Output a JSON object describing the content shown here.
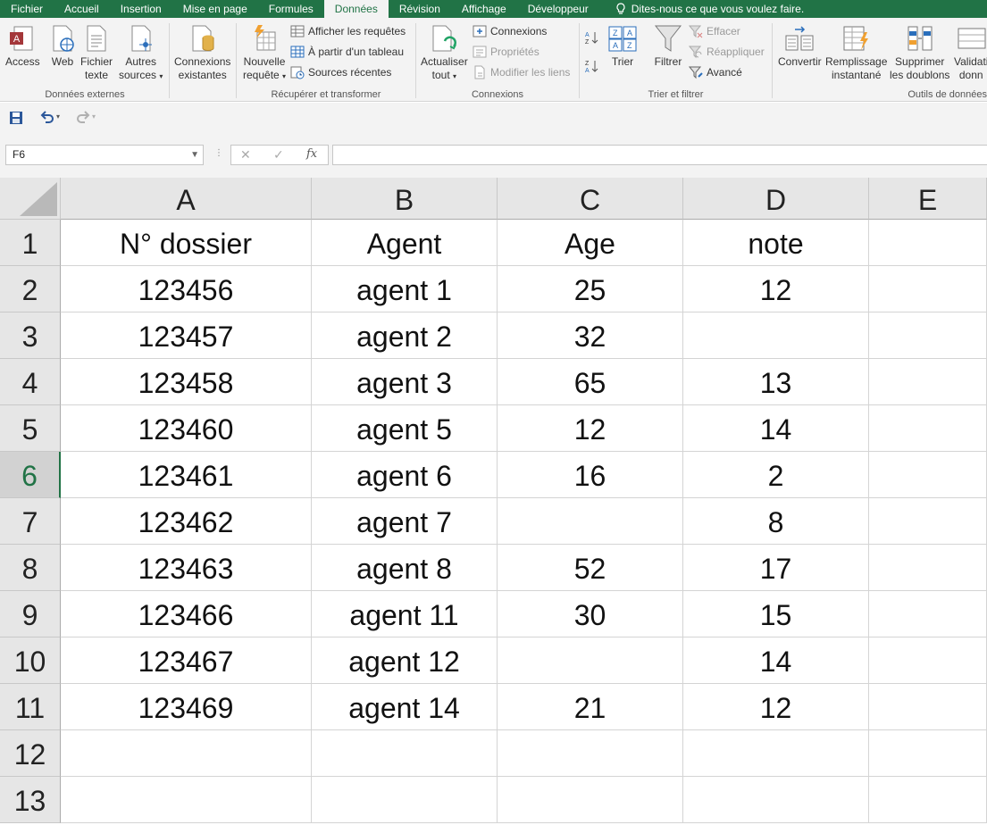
{
  "tabs": [
    {
      "label": "Fichier",
      "active": false
    },
    {
      "label": "Accueil",
      "active": false
    },
    {
      "label": "Insertion",
      "active": false
    },
    {
      "label": "Mise en page",
      "active": false
    },
    {
      "label": "Formules",
      "active": false
    },
    {
      "label": "Données",
      "active": true
    },
    {
      "label": "Révision",
      "active": false
    },
    {
      "label": "Affichage",
      "active": false
    },
    {
      "label": "Développeur",
      "active": false
    }
  ],
  "tell_me": "Dites-nous ce que vous voulez faire.",
  "ribbon": {
    "donnees_externes": {
      "label": "Données externes",
      "access": "Access",
      "web": "Web",
      "fichier_texte_1": "Fichier",
      "fichier_texte_2": "texte",
      "autres_1": "Autres",
      "autres_2": "sources",
      "connexions_exist_1": "Connexions",
      "connexions_exist_2": "existantes"
    },
    "recuperer": {
      "label": "Récupérer et transformer",
      "nouvelle_1": "Nouvelle",
      "nouvelle_2": "requête",
      "afficher": "Afficher les requêtes",
      "partir": "À partir d'un tableau",
      "sources": "Sources récentes"
    },
    "connexions": {
      "label": "Connexions",
      "actualiser_1": "Actualiser",
      "actualiser_2": "tout",
      "connexions": "Connexions",
      "proprietes": "Propriétés",
      "modifier": "Modifier les liens"
    },
    "trier": {
      "label": "Trier et filtrer",
      "trier": "Trier",
      "filtrer": "Filtrer",
      "effacer": "Effacer",
      "reappliquer": "Réappliquer",
      "avance": "Avancé"
    },
    "outils": {
      "label": "Outils de données",
      "convertir": "Convertir",
      "remplissage_1": "Remplissage",
      "remplissage_2": "instantané",
      "supprimer_1": "Supprimer",
      "supprimer_2": "les doublons",
      "validation_1": "Validati",
      "validation_2": "donn"
    }
  },
  "namebox": "F6",
  "formula": "",
  "fx_label": "fx",
  "columns": [
    "A",
    "B",
    "C",
    "D",
    "E"
  ],
  "row_numbers": [
    "1",
    "2",
    "3",
    "4",
    "5",
    "6",
    "7",
    "8",
    "9",
    "10",
    "11",
    "12",
    "13"
  ],
  "selected_row": "6",
  "rows": [
    [
      "N° dossier",
      "Agent",
      "Age",
      "note",
      ""
    ],
    [
      "123456",
      "agent 1",
      "25",
      "12",
      ""
    ],
    [
      "123457",
      "agent 2",
      "32",
      "",
      ""
    ],
    [
      "123458",
      "agent 3",
      "65",
      "13",
      ""
    ],
    [
      "123460",
      "agent 5",
      "12",
      "14",
      ""
    ],
    [
      "123461",
      "agent 6",
      "16",
      "2",
      ""
    ],
    [
      "123462",
      "agent 7",
      "",
      "8",
      ""
    ],
    [
      "123463",
      "agent 8",
      "52",
      "17",
      ""
    ],
    [
      "123466",
      "agent 11",
      "30",
      "15",
      ""
    ],
    [
      "123467",
      "agent 12",
      "",
      "14",
      ""
    ],
    [
      "123469",
      "agent 14",
      "21",
      "12",
      ""
    ],
    [
      "",
      "",
      "",
      "",
      ""
    ],
    [
      "",
      "",
      "",
      "",
      ""
    ]
  ],
  "colors": {
    "accent": "#217346"
  }
}
